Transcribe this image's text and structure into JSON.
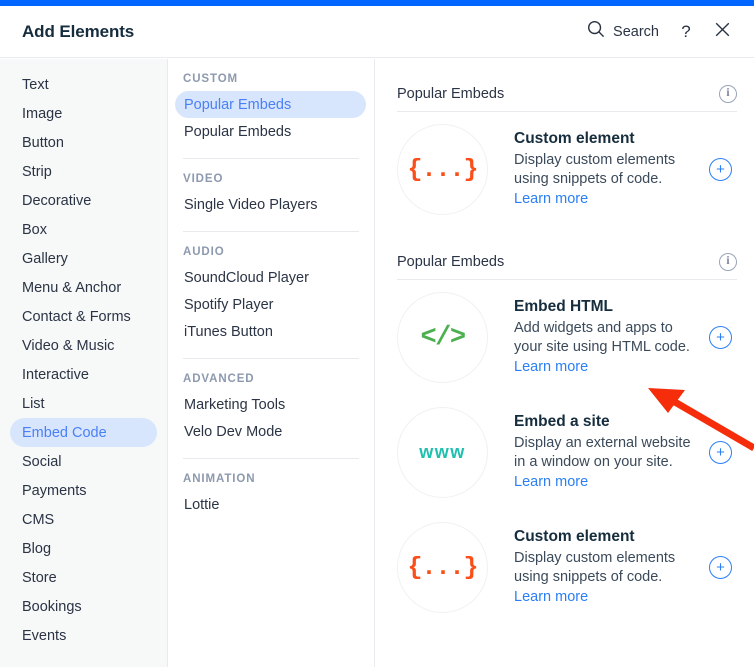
{
  "window": {
    "accent_color": "#0066ff",
    "title": "Add Elements"
  },
  "header": {
    "title": "Add Elements",
    "search_label": "Search",
    "search_icon": "search-icon",
    "help_label": "?",
    "close_label": "✕"
  },
  "sidebar": {
    "items": [
      {
        "label": "Text",
        "active": false
      },
      {
        "label": "Image",
        "active": false
      },
      {
        "label": "Button",
        "active": false
      },
      {
        "label": "Strip",
        "active": false
      },
      {
        "label": "Decorative",
        "active": false
      },
      {
        "label": "Box",
        "active": false
      },
      {
        "label": "Gallery",
        "active": false
      },
      {
        "label": "Menu & Anchor",
        "active": false
      },
      {
        "label": "Contact & Forms",
        "active": false
      },
      {
        "label": "Video & Music",
        "active": false
      },
      {
        "label": "Interactive",
        "active": false
      },
      {
        "label": "List",
        "active": false
      },
      {
        "label": "Embed Code",
        "active": true
      },
      {
        "label": "Social",
        "active": false
      },
      {
        "label": "Payments",
        "active": false
      },
      {
        "label": "CMS",
        "active": false
      },
      {
        "label": "Blog",
        "active": false
      },
      {
        "label": "Store",
        "active": false
      },
      {
        "label": "Bookings",
        "active": false
      },
      {
        "label": "Events",
        "active": false
      }
    ],
    "active_item": "Embed Code",
    "active_pill_bg": "#d8e6fd",
    "active_text_color": "#4a7ff7"
  },
  "midcol": {
    "groups": [
      {
        "label": "CUSTOM",
        "items": [
          {
            "label": "Popular Embeds",
            "active": true
          },
          {
            "label": "Popular Embeds",
            "active": false
          }
        ]
      },
      {
        "label": "VIDEO",
        "items": [
          {
            "label": "Single Video Players",
            "active": false
          }
        ]
      },
      {
        "label": "AUDIO",
        "items": [
          {
            "label": "SoundCloud Player",
            "active": false
          },
          {
            "label": "Spotify Player",
            "active": false
          },
          {
            "label": "iTunes Button",
            "active": false
          }
        ]
      },
      {
        "label": "ADVANCED",
        "items": [
          {
            "label": "Marketing Tools",
            "active": false
          },
          {
            "label": "Velo Dev Mode",
            "active": false
          }
        ]
      },
      {
        "label": "ANIMATION",
        "items": [
          {
            "label": "Lottie",
            "active": false
          }
        ]
      }
    ]
  },
  "content": {
    "sections": [
      {
        "title": "Popular Embeds",
        "info_icon": "info-icon",
        "cards": [
          {
            "icon": "curly-braces-icon",
            "icon_glyph": "{...}",
            "icon_color": "#fa4f19",
            "title": "Custom element",
            "desc": "Display custom elements using snippets of code. ",
            "link": "Learn more",
            "add_label": "+"
          }
        ]
      },
      {
        "title": "Popular Embeds",
        "info_icon": "info-icon",
        "cards": [
          {
            "icon": "code-tag-icon",
            "icon_glyph": "</>",
            "icon_color": "#4caf50",
            "title": "Embed HTML",
            "desc": "Add widgets and apps to your site using HTML code. ",
            "link": "Learn more",
            "add_label": "+"
          },
          {
            "icon": "www-icon",
            "icon_glyph": "www",
            "icon_color": "#1fc0b0",
            "title": "Embed a site",
            "desc": "Display an external website in a window on your site. ",
            "link": "Learn more",
            "add_label": "+"
          },
          {
            "icon": "curly-braces-icon",
            "icon_glyph": "{...}",
            "icon_color": "#fa4f19",
            "title": "Custom element",
            "desc": "Display custom elements using snippets of code. ",
            "link": "Learn more",
            "add_label": "+"
          }
        ]
      }
    ]
  },
  "annotation": {
    "arrow_color": "#f52d0a",
    "points_to": "Learn more"
  }
}
